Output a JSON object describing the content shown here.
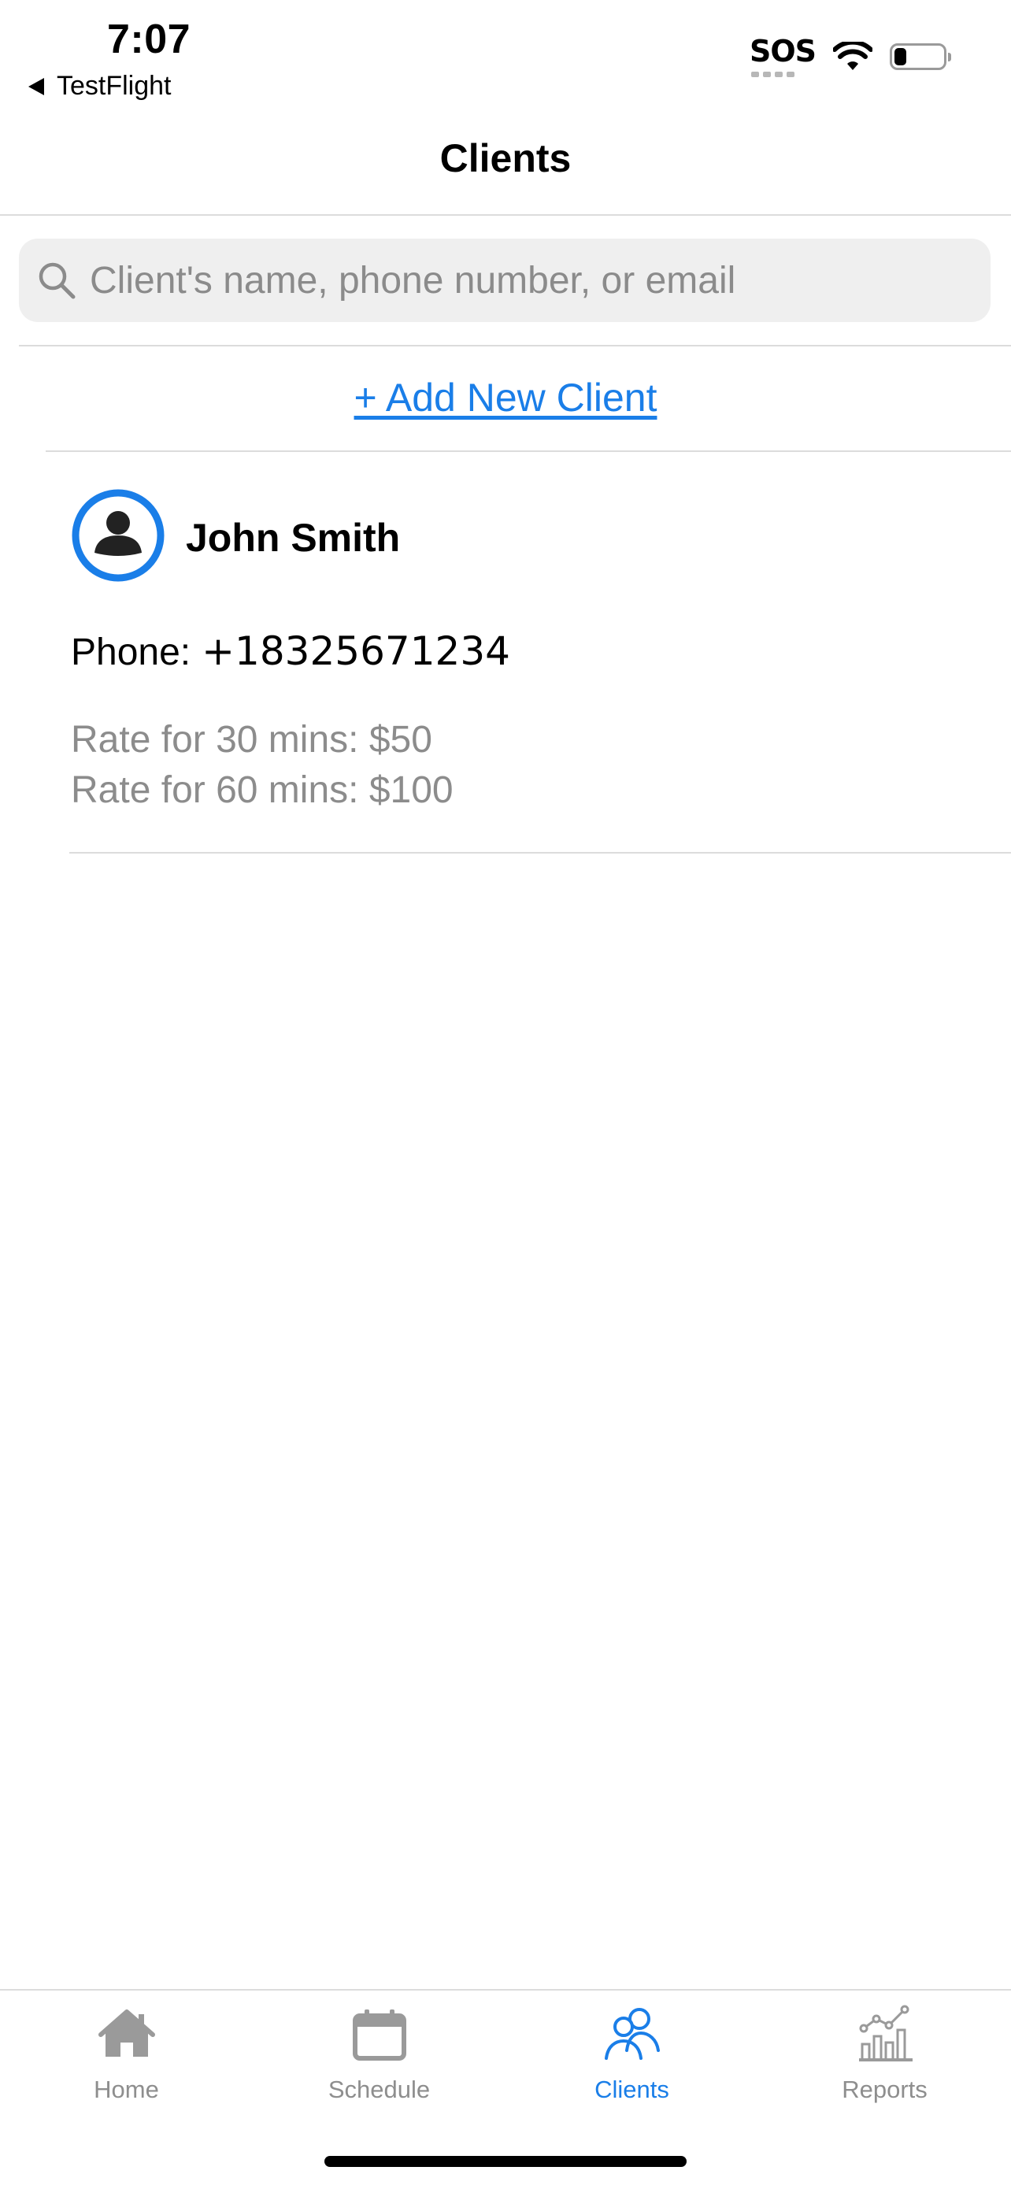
{
  "status_bar": {
    "time": "7:07",
    "back_app": "TestFlight",
    "sos": "SOS",
    "battery_level": 0.25,
    "icons": [
      "sos-icon",
      "wifi-icon",
      "battery-icon"
    ]
  },
  "nav": {
    "title": "Clients"
  },
  "search": {
    "placeholder": "Client's name, phone number, or email",
    "value": "",
    "icon": "search-icon"
  },
  "add_client": {
    "label": "+ Add New Client"
  },
  "clients": [
    {
      "name": "John Smith",
      "phone_label": "Phone:",
      "phone": "+18325671234",
      "rate_30": "Rate for 30 mins: $50",
      "rate_60": "Rate for 60 mins: $100",
      "icon": "person-icon"
    }
  ],
  "tabs": [
    {
      "label": "Home",
      "icon": "house-icon",
      "active": false
    },
    {
      "label": "Schedule",
      "icon": "calendar-icon",
      "active": false
    },
    {
      "label": "Clients",
      "icon": "people-icon",
      "active": true
    },
    {
      "label": "Reports",
      "icon": "chart-icon",
      "active": false
    }
  ],
  "colors": {
    "accent": "#1a7ee8",
    "inactive_tab": "#8e8e8e",
    "secondary_text": "#8c8c8c",
    "search_bg": "#efefef",
    "divider": "#dcdcdc"
  }
}
